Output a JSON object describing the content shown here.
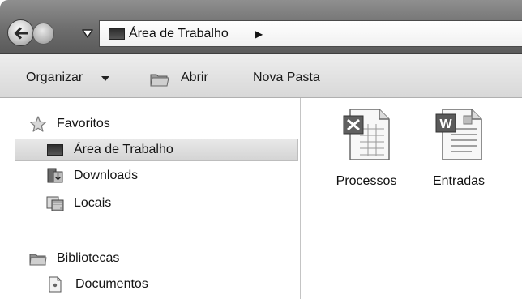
{
  "address_bar": {
    "location": "Área de Trabalho",
    "separator": "▶"
  },
  "toolbar": {
    "organizar_label": "Organizar",
    "abrir_label": "Abrir",
    "nova_pasta_label": "Nova Pasta"
  },
  "nav_pane": {
    "favorites": {
      "label": "Favoritos",
      "items": [
        {
          "label": "Área de Trabalho",
          "icon": "desktop-icon",
          "selected": true
        },
        {
          "label": "Downloads",
          "icon": "downloads-icon",
          "selected": false
        },
        {
          "label": "Locais",
          "icon": "locais-icon",
          "selected": false
        }
      ]
    },
    "libraries": {
      "label": "Bibliotecas",
      "items": [
        {
          "label": "Documentos",
          "icon": "documents-icon"
        }
      ]
    }
  },
  "files": [
    {
      "name": "Processos",
      "icon": "spreadsheet-file-icon"
    },
    {
      "name": "Entradas",
      "icon": "word-document-icon"
    }
  ]
}
